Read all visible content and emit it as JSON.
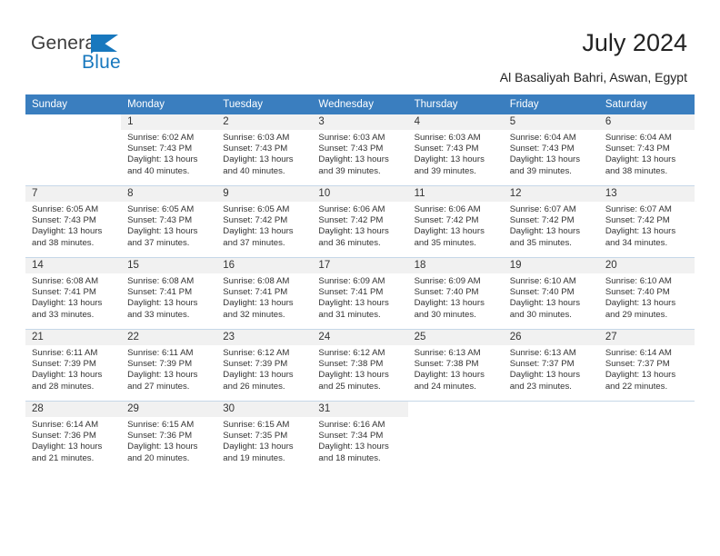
{
  "brand": {
    "name_part1": "General",
    "name_part2": "Blue",
    "accent_color": "#1878be",
    "flag_icon": "triangle-flag-icon"
  },
  "header": {
    "title": "July 2024",
    "subtitle": "Al Basaliyah Bahri, Aswan, Egypt"
  },
  "calendar": {
    "header_bg": "#3a7ebf",
    "daynum_bg": "#f1f1f1",
    "weekday_headers": [
      "Sunday",
      "Monday",
      "Tuesday",
      "Wednesday",
      "Thursday",
      "Friday",
      "Saturday"
    ],
    "weeks": [
      [
        {
          "day": "",
          "sunrise": "",
          "sunset": "",
          "daylight_1": "",
          "daylight_2": ""
        },
        {
          "day": "1",
          "sunrise": "Sunrise: 6:02 AM",
          "sunset": "Sunset: 7:43 PM",
          "daylight_1": "Daylight: 13 hours",
          "daylight_2": "and 40 minutes."
        },
        {
          "day": "2",
          "sunrise": "Sunrise: 6:03 AM",
          "sunset": "Sunset: 7:43 PM",
          "daylight_1": "Daylight: 13 hours",
          "daylight_2": "and 40 minutes."
        },
        {
          "day": "3",
          "sunrise": "Sunrise: 6:03 AM",
          "sunset": "Sunset: 7:43 PM",
          "daylight_1": "Daylight: 13 hours",
          "daylight_2": "and 39 minutes."
        },
        {
          "day": "4",
          "sunrise": "Sunrise: 6:03 AM",
          "sunset": "Sunset: 7:43 PM",
          "daylight_1": "Daylight: 13 hours",
          "daylight_2": "and 39 minutes."
        },
        {
          "day": "5",
          "sunrise": "Sunrise: 6:04 AM",
          "sunset": "Sunset: 7:43 PM",
          "daylight_1": "Daylight: 13 hours",
          "daylight_2": "and 39 minutes."
        },
        {
          "day": "6",
          "sunrise": "Sunrise: 6:04 AM",
          "sunset": "Sunset: 7:43 PM",
          "daylight_1": "Daylight: 13 hours",
          "daylight_2": "and 38 minutes."
        }
      ],
      [
        {
          "day": "7",
          "sunrise": "Sunrise: 6:05 AM",
          "sunset": "Sunset: 7:43 PM",
          "daylight_1": "Daylight: 13 hours",
          "daylight_2": "and 38 minutes."
        },
        {
          "day": "8",
          "sunrise": "Sunrise: 6:05 AM",
          "sunset": "Sunset: 7:43 PM",
          "daylight_1": "Daylight: 13 hours",
          "daylight_2": "and 37 minutes."
        },
        {
          "day": "9",
          "sunrise": "Sunrise: 6:05 AM",
          "sunset": "Sunset: 7:42 PM",
          "daylight_1": "Daylight: 13 hours",
          "daylight_2": "and 37 minutes."
        },
        {
          "day": "10",
          "sunrise": "Sunrise: 6:06 AM",
          "sunset": "Sunset: 7:42 PM",
          "daylight_1": "Daylight: 13 hours",
          "daylight_2": "and 36 minutes."
        },
        {
          "day": "11",
          "sunrise": "Sunrise: 6:06 AM",
          "sunset": "Sunset: 7:42 PM",
          "daylight_1": "Daylight: 13 hours",
          "daylight_2": "and 35 minutes."
        },
        {
          "day": "12",
          "sunrise": "Sunrise: 6:07 AM",
          "sunset": "Sunset: 7:42 PM",
          "daylight_1": "Daylight: 13 hours",
          "daylight_2": "and 35 minutes."
        },
        {
          "day": "13",
          "sunrise": "Sunrise: 6:07 AM",
          "sunset": "Sunset: 7:42 PM",
          "daylight_1": "Daylight: 13 hours",
          "daylight_2": "and 34 minutes."
        }
      ],
      [
        {
          "day": "14",
          "sunrise": "Sunrise: 6:08 AM",
          "sunset": "Sunset: 7:41 PM",
          "daylight_1": "Daylight: 13 hours",
          "daylight_2": "and 33 minutes."
        },
        {
          "day": "15",
          "sunrise": "Sunrise: 6:08 AM",
          "sunset": "Sunset: 7:41 PM",
          "daylight_1": "Daylight: 13 hours",
          "daylight_2": "and 33 minutes."
        },
        {
          "day": "16",
          "sunrise": "Sunrise: 6:08 AM",
          "sunset": "Sunset: 7:41 PM",
          "daylight_1": "Daylight: 13 hours",
          "daylight_2": "and 32 minutes."
        },
        {
          "day": "17",
          "sunrise": "Sunrise: 6:09 AM",
          "sunset": "Sunset: 7:41 PM",
          "daylight_1": "Daylight: 13 hours",
          "daylight_2": "and 31 minutes."
        },
        {
          "day": "18",
          "sunrise": "Sunrise: 6:09 AM",
          "sunset": "Sunset: 7:40 PM",
          "daylight_1": "Daylight: 13 hours",
          "daylight_2": "and 30 minutes."
        },
        {
          "day": "19",
          "sunrise": "Sunrise: 6:10 AM",
          "sunset": "Sunset: 7:40 PM",
          "daylight_1": "Daylight: 13 hours",
          "daylight_2": "and 30 minutes."
        },
        {
          "day": "20",
          "sunrise": "Sunrise: 6:10 AM",
          "sunset": "Sunset: 7:40 PM",
          "daylight_1": "Daylight: 13 hours",
          "daylight_2": "and 29 minutes."
        }
      ],
      [
        {
          "day": "21",
          "sunrise": "Sunrise: 6:11 AM",
          "sunset": "Sunset: 7:39 PM",
          "daylight_1": "Daylight: 13 hours",
          "daylight_2": "and 28 minutes."
        },
        {
          "day": "22",
          "sunrise": "Sunrise: 6:11 AM",
          "sunset": "Sunset: 7:39 PM",
          "daylight_1": "Daylight: 13 hours",
          "daylight_2": "and 27 minutes."
        },
        {
          "day": "23",
          "sunrise": "Sunrise: 6:12 AM",
          "sunset": "Sunset: 7:39 PM",
          "daylight_1": "Daylight: 13 hours",
          "daylight_2": "and 26 minutes."
        },
        {
          "day": "24",
          "sunrise": "Sunrise: 6:12 AM",
          "sunset": "Sunset: 7:38 PM",
          "daylight_1": "Daylight: 13 hours",
          "daylight_2": "and 25 minutes."
        },
        {
          "day": "25",
          "sunrise": "Sunrise: 6:13 AM",
          "sunset": "Sunset: 7:38 PM",
          "daylight_1": "Daylight: 13 hours",
          "daylight_2": "and 24 minutes."
        },
        {
          "day": "26",
          "sunrise": "Sunrise: 6:13 AM",
          "sunset": "Sunset: 7:37 PM",
          "daylight_1": "Daylight: 13 hours",
          "daylight_2": "and 23 minutes."
        },
        {
          "day": "27",
          "sunrise": "Sunrise: 6:14 AM",
          "sunset": "Sunset: 7:37 PM",
          "daylight_1": "Daylight: 13 hours",
          "daylight_2": "and 22 minutes."
        }
      ],
      [
        {
          "day": "28",
          "sunrise": "Sunrise: 6:14 AM",
          "sunset": "Sunset: 7:36 PM",
          "daylight_1": "Daylight: 13 hours",
          "daylight_2": "and 21 minutes."
        },
        {
          "day": "29",
          "sunrise": "Sunrise: 6:15 AM",
          "sunset": "Sunset: 7:36 PM",
          "daylight_1": "Daylight: 13 hours",
          "daylight_2": "and 20 minutes."
        },
        {
          "day": "30",
          "sunrise": "Sunrise: 6:15 AM",
          "sunset": "Sunset: 7:35 PM",
          "daylight_1": "Daylight: 13 hours",
          "daylight_2": "and 19 minutes."
        },
        {
          "day": "31",
          "sunrise": "Sunrise: 6:16 AM",
          "sunset": "Sunset: 7:34 PM",
          "daylight_1": "Daylight: 13 hours",
          "daylight_2": "and 18 minutes."
        },
        {
          "day": "",
          "sunrise": "",
          "sunset": "",
          "daylight_1": "",
          "daylight_2": ""
        },
        {
          "day": "",
          "sunrise": "",
          "sunset": "",
          "daylight_1": "",
          "daylight_2": ""
        },
        {
          "day": "",
          "sunrise": "",
          "sunset": "",
          "daylight_1": "",
          "daylight_2": ""
        }
      ]
    ]
  }
}
